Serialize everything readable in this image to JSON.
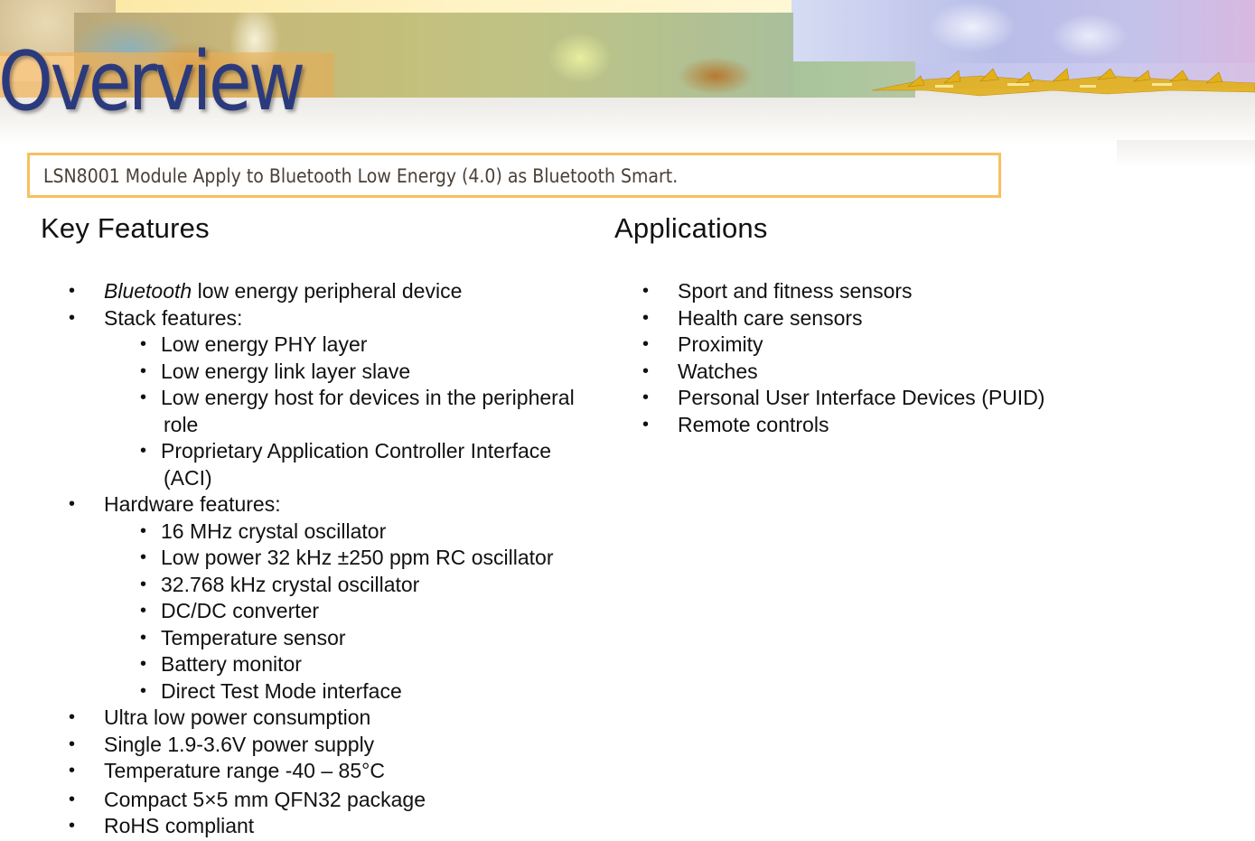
{
  "slide": {
    "title": "Overview",
    "summary": "LSN8001 Module  Apply to Bluetooth Low Energy (4.0) as Bluetooth Smart.",
    "colors": {
      "title": "#2b3a7c",
      "summary_border": "#f8c060",
      "summary_text": "#4a4036",
      "body_text": "#111111"
    }
  },
  "key_features": {
    "heading": "Key Features",
    "items": {
      "bluetooth_italic": "Bluetooth",
      "bluetooth_rest": " low energy peripheral device",
      "stack": "Stack features:",
      "stack_phy": "Low energy PHY layer",
      "stack_link": "Low energy link layer slave",
      "stack_host_1": "Low energy host for devices in the peripheral",
      "stack_host_2": "role",
      "stack_aci_1": "Proprietary Application Controller Interface",
      "stack_aci_2": "(ACI)",
      "hardware": "Hardware features:",
      "hw_16mhz": "16 MHz crystal oscillator",
      "hw_rc": "Low power 32 kHz ±250 ppm RC oscillator",
      "hw_32768": "32.768 kHz crystal oscillator",
      "hw_dcdc": "DC/DC converter",
      "hw_temp": "Temperature sensor",
      "hw_batt": "Battery monitor",
      "hw_dtm": "Direct Test Mode interface",
      "ulp": "Ultra low power consumption",
      "supply": "Single 1.9-3.6V power supply",
      "temp_range": "Temperature range -40 –  85°C",
      "package": "Compact 5×5 mm QFN32 package",
      "rohs": "RoHS compliant"
    },
    "bullet": "•"
  },
  "applications": {
    "heading": "Applications",
    "items": [
      "Sport and fitness sensors",
      "Health care sensors",
      "Proximity",
      "Watches",
      "Personal User Interface Devices (PUID)",
      "Remote controls"
    ],
    "bullet": "•"
  }
}
